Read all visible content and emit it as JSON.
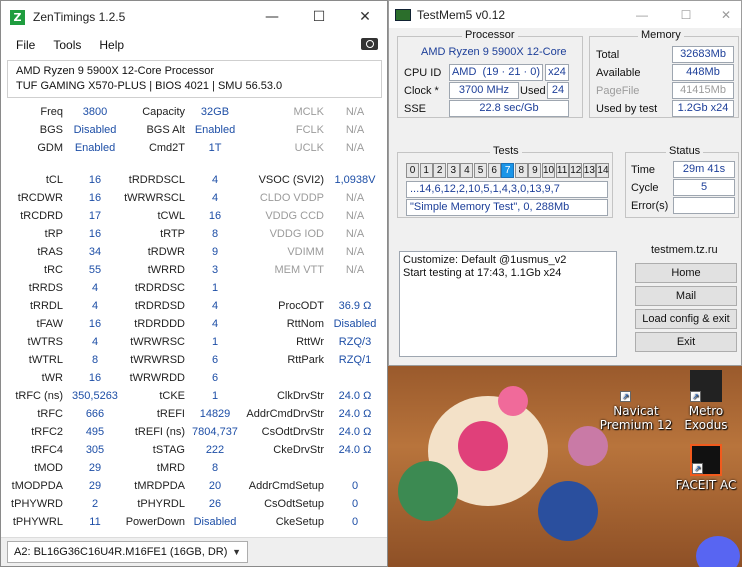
{
  "zen": {
    "title": "ZenTimings 1.2.5",
    "menu": [
      "File",
      "Tools",
      "Help"
    ],
    "cpu": "AMD Ryzen 9 5900X 12-Core Processor",
    "board": "TUF GAMING X570-PLUS | BIOS 4021 | SMU 56.53.0",
    "rows": [
      [
        [
          "Freq",
          "3800"
        ],
        [
          "Capacity",
          "32GB"
        ],
        [
          "MCLK",
          "N/A",
          1
        ]
      ],
      [
        [
          "BGS",
          "Disabled"
        ],
        [
          "BGS Alt",
          "Enabled"
        ],
        [
          "FCLK",
          "N/A",
          1
        ]
      ],
      [
        [
          "GDM",
          "Enabled"
        ],
        [
          "Cmd2T",
          "1T"
        ],
        [
          "UCLK",
          "N/A",
          1
        ]
      ],
      null,
      [
        [
          "tCL",
          "16"
        ],
        [
          "tRDRDSCL",
          "4"
        ],
        [
          "VSOC (SVI2)",
          "1,0938V"
        ]
      ],
      [
        [
          "tRCDWR",
          "16"
        ],
        [
          "tWRWRSCL",
          "4"
        ],
        [
          "CLDO VDDP",
          "N/A",
          1
        ]
      ],
      [
        [
          "tRCDRD",
          "17"
        ],
        [
          "tCWL",
          "16"
        ],
        [
          "VDDG CCD",
          "N/A",
          1
        ]
      ],
      [
        [
          "tRP",
          "16"
        ],
        [
          "tRTP",
          "8"
        ],
        [
          "VDDG IOD",
          "N/A",
          1
        ]
      ],
      [
        [
          "tRAS",
          "34"
        ],
        [
          "tRDWR",
          "9"
        ],
        [
          "VDIMM",
          "N/A",
          1
        ]
      ],
      [
        [
          "tRC",
          "55"
        ],
        [
          "tWRRD",
          "3"
        ],
        [
          "MEM VTT",
          "N/A",
          1
        ]
      ],
      [
        [
          "tRRDS",
          "4"
        ],
        [
          "tRDRDSC",
          "1"
        ],
        null
      ],
      [
        [
          "tRRDL",
          "4"
        ],
        [
          "tRDRDSD",
          "4"
        ],
        [
          "ProcODT",
          "36.9 Ω"
        ]
      ],
      [
        [
          "tFAW",
          "16"
        ],
        [
          "tRDRDDD",
          "4"
        ],
        [
          "RttNom",
          "Disabled"
        ]
      ],
      [
        [
          "tWTRS",
          "4"
        ],
        [
          "tWRWRSC",
          "1"
        ],
        [
          "RttWr",
          "RZQ/3"
        ]
      ],
      [
        [
          "tWTRL",
          "8"
        ],
        [
          "tWRWRSD",
          "6"
        ],
        [
          "RttPark",
          "RZQ/1"
        ]
      ],
      [
        [
          "tWR",
          "16"
        ],
        [
          "tWRWRDD",
          "6"
        ],
        null
      ],
      [
        [
          "tRFC (ns)",
          "350,5263"
        ],
        [
          "tCKE",
          "1"
        ],
        [
          "ClkDrvStr",
          "24.0 Ω"
        ]
      ],
      [
        [
          "tRFC",
          "666"
        ],
        [
          "tREFI",
          "14829"
        ],
        [
          "AddrCmdDrvStr",
          "24.0 Ω"
        ]
      ],
      [
        [
          "tRFC2",
          "495"
        ],
        [
          "tREFI (ns)",
          "7804,737"
        ],
        [
          "CsOdtDrvStr",
          "24.0 Ω"
        ]
      ],
      [
        [
          "tRFC4",
          "305"
        ],
        [
          "tSTAG",
          "222"
        ],
        [
          "CkeDrvStr",
          "24.0 Ω"
        ]
      ],
      [
        [
          "tMOD",
          "29"
        ],
        [
          "tMRD",
          "8"
        ],
        null
      ],
      [
        [
          "tMODPDA",
          "29"
        ],
        [
          "tMRDPDA",
          "20"
        ],
        [
          "AddrCmdSetup",
          "0"
        ]
      ],
      [
        [
          "tPHYWRD",
          "2"
        ],
        [
          "tPHYRDL",
          "26"
        ],
        [
          "CsOdtSetup",
          "0"
        ]
      ],
      [
        [
          "tPHYWRL",
          "11"
        ],
        [
          "PowerDown",
          "Disabled"
        ],
        [
          "CkeSetup",
          "0"
        ]
      ]
    ],
    "dimm": "A2: BL16G36C16U4R.M16FE1 (16GB, DR)"
  },
  "tm": {
    "title": "TestMem5 v0.12",
    "processor": {
      "title": "Processor",
      "name": "AMD Ryzen 9 5900X 12-Core",
      "cpuid_label": "CPU ID",
      "cpuid_vendor": "AMD",
      "cpuid": "(19 · 21 · 0)",
      "threads": "x24",
      "clock_label": "Clock *",
      "clock": "3700 MHz",
      "used_label": "Used",
      "used": "24",
      "sse_label": "SSE",
      "sse": "22.8 sec/Gb"
    },
    "memory": {
      "title": "Memory",
      "total_label": "Total",
      "total": "32683Mb",
      "available_label": "Available",
      "available": "448Mb",
      "pagefile_label": "PageFile",
      "pagefile": "41415Mb",
      "usedbytest_label": "Used by test",
      "usedbytest": "1.2Gb x24"
    },
    "tests": {
      "title": "Tests",
      "boxes": [
        "0",
        "1",
        "2",
        "3",
        "4",
        "5",
        "6",
        "7",
        "8",
        "9",
        "10",
        "11",
        "12",
        "13",
        "14"
      ],
      "active_index": 7,
      "sequence": "...14,6,12,2,10,5,1,4,3,0,13,9,7",
      "current": "\"Simple Memory Test\", 0, 288Mb"
    },
    "status": {
      "title": "Status",
      "time_label": "Time",
      "time": "29m 41s",
      "cycle_label": "Cycle",
      "cycle": "5",
      "errors_label": "Error(s)",
      "errors": ""
    },
    "log": [
      "Customize: Default @1usmus_v2",
      "Start testing at 17:43, 1.1Gb x24"
    ],
    "site": "testmem.tz.ru",
    "buttons": [
      "Home",
      "Mail",
      "Load config & exit",
      "Exit"
    ]
  },
  "desktop": {
    "icons": [
      {
        "label": "Navicat Premium 12"
      },
      {
        "label": "Metro Exodus"
      },
      {
        "label": "FACEIT AC"
      }
    ]
  },
  "colors": {
    "active_test": "#1a95e8",
    "value_blue": "#1d4ea6",
    "zen_icon": "#1f9d3f"
  }
}
